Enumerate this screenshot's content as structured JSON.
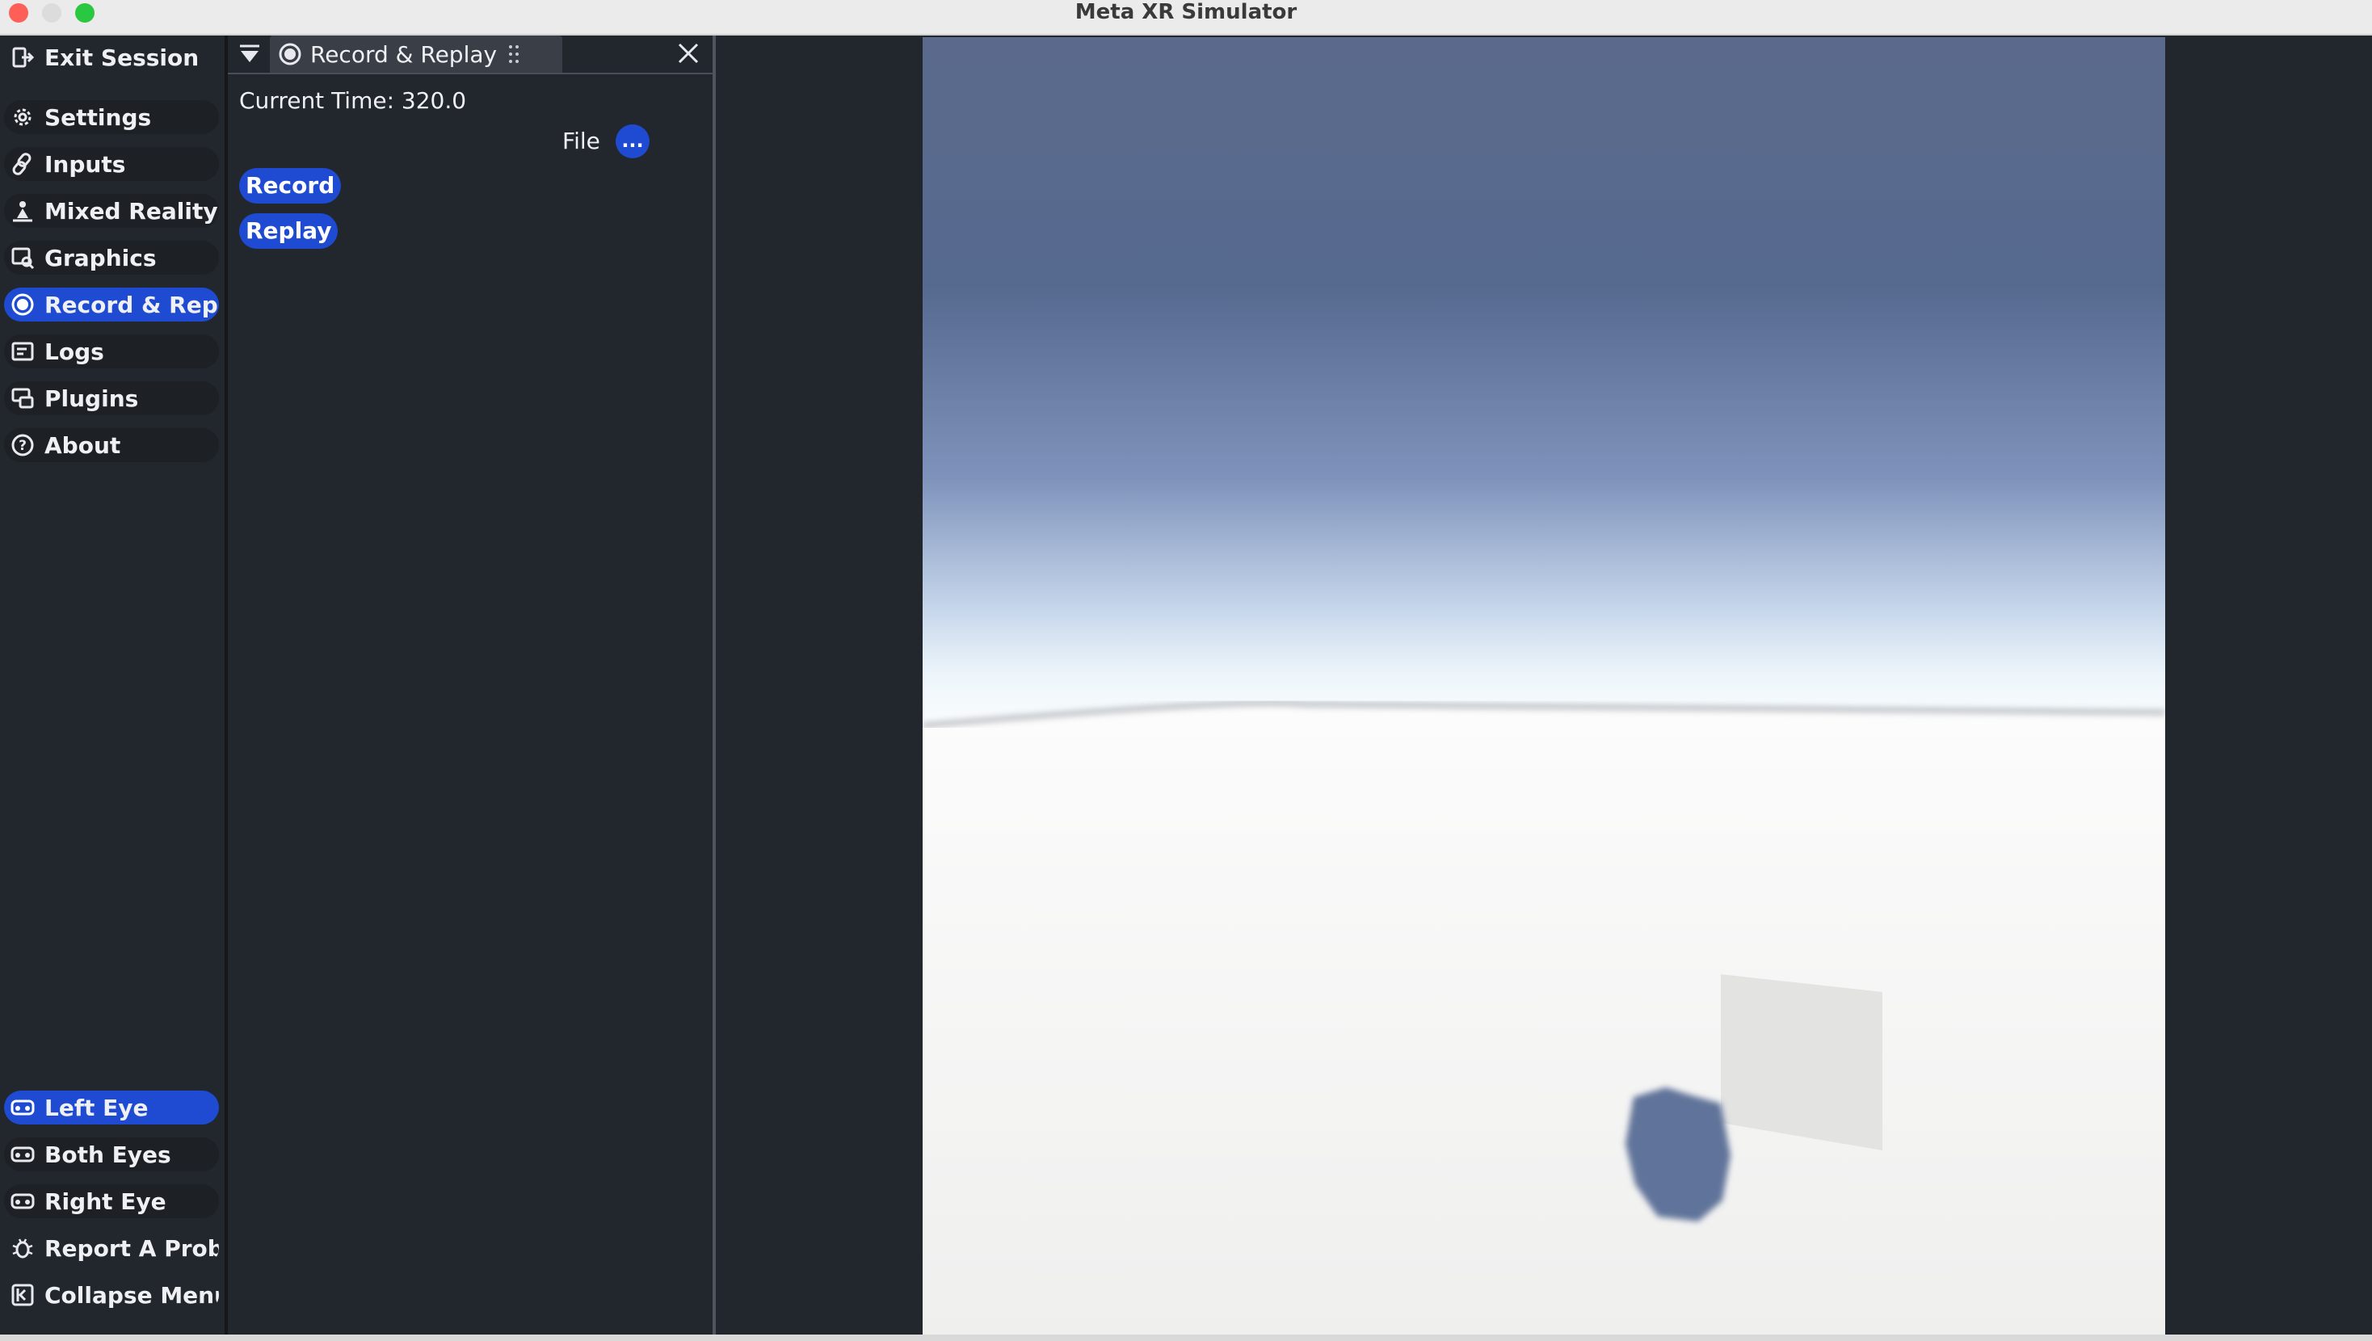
{
  "window": {
    "title": "Meta XR Simulator"
  },
  "menu": {
    "top_items": [
      {
        "label": "Exit Session",
        "icon": "exit-session-icon"
      },
      {
        "label": "Settings",
        "icon": "gear-icon"
      },
      {
        "label": "Inputs",
        "icon": "link-icon"
      },
      {
        "label": "Mixed Reality",
        "icon": "mixed-reality-icon"
      },
      {
        "label": "Graphics",
        "icon": "graphics-icon"
      },
      {
        "label": "Record & Replay",
        "icon": "record-icon",
        "active": true
      },
      {
        "label": "Logs",
        "icon": "logs-icon"
      },
      {
        "label": "Plugins",
        "icon": "plugins-icon"
      },
      {
        "label": "About",
        "icon": "question-icon"
      }
    ],
    "bottom_items": [
      {
        "label": "Left Eye",
        "icon": "headset-icon",
        "active": true
      },
      {
        "label": "Both Eyes",
        "icon": "headset-icon"
      },
      {
        "label": "Right Eye",
        "icon": "headset-icon"
      },
      {
        "label": "Report A Problem",
        "icon": "bug-icon"
      },
      {
        "label": "Collapse Menu",
        "icon": "collapse-icon"
      }
    ]
  },
  "panel": {
    "tab_label": "Record & Replay",
    "current_time_label": "Current Time: 320.0",
    "file_input_value": "",
    "file_label": "File",
    "browse_label": "...",
    "record_label": "Record",
    "replay_label": "Replay"
  },
  "colors": {
    "accent": "#1e4bd2",
    "background": "#22262d",
    "sky_top": "#5a6a8c",
    "floor": "#f3f3f2"
  }
}
